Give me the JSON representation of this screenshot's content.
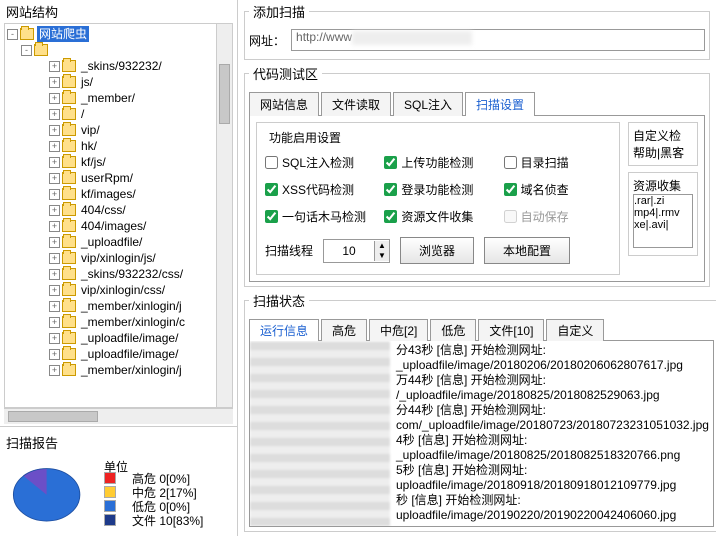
{
  "left": {
    "title": "网站结构",
    "root_label": "网站爬虫",
    "nodes": [
      "_skins/932232/",
      "js/",
      "_member/",
      "/",
      "vip/",
      "hk/",
      "kf/js/",
      "userRpm/",
      "kf/images/",
      "404/css/",
      "404/images/",
      "_uploadfile/",
      "vip/xinlogin/js/",
      "_skins/932232/css/",
      "vip/xinlogin/css/",
      "_member/xinlogin/j",
      "_member/xinlogin/c",
      "_uploadfile/image/",
      "_uploadfile/image/",
      "_member/xinlogin/j"
    ],
    "report_title": "扫描报告",
    "report_unit": "单位",
    "report_items": [
      {
        "label": "高危",
        "value": "0[0%]"
      },
      {
        "label": "中危",
        "value": "2[17%]"
      },
      {
        "label": "低危",
        "value": "0[0%]"
      },
      {
        "label": "文件",
        "value": "10[83%]"
      }
    ]
  },
  "chart_data": {
    "type": "pie",
    "title": "扫描报告",
    "categories": [
      "高危",
      "中危",
      "低危",
      "文件"
    ],
    "values": [
      0,
      17,
      0,
      83
    ],
    "colors": [
      "#e22222",
      "#ffcc33",
      "#2a6fd6",
      "#1e3a8a"
    ]
  },
  "add_scan": {
    "title": "添加扫描",
    "url_label": "网址：",
    "url_value": "http://www"
  },
  "code_test": {
    "title": "代码测试区",
    "tabs": [
      "网站信息",
      "文件读取",
      "SQL注入",
      "扫描设置"
    ],
    "active_tab": 3,
    "func_title": "功能启用设置",
    "checks": [
      {
        "label": "SQL注入检测",
        "checked": false
      },
      {
        "label": "上传功能检测",
        "checked": true
      },
      {
        "label": "目录扫描",
        "checked": false
      },
      {
        "label": "XSS代码检测",
        "checked": true
      },
      {
        "label": "登录功能检测",
        "checked": true
      },
      {
        "label": "域名侦查",
        "checked": true
      },
      {
        "label": "一句话木马检测",
        "checked": true
      },
      {
        "label": "资源文件收集",
        "checked": true
      },
      {
        "label": "自动保存",
        "checked": false,
        "disabled": true
      }
    ],
    "thread_label": "扫描线程",
    "thread_value": "10",
    "browser_btn": "浏览器",
    "local_btn": "本地配置",
    "custom_title": "自定义检",
    "custom_hint": "帮助|黑客",
    "resource_title": "资源收集",
    "resource_ext": ".rar|.zi\nmp4|.rmv\nxe|.avi|"
  },
  "scan_status": {
    "title": "扫描状态",
    "tabs": [
      "运行信息",
      "高危",
      "中危[2]",
      "低危",
      "文件[10]",
      "自定义"
    ],
    "active_tab": 0,
    "log_lines": [
      "分43秒      [信息]  开始检测网址:",
      "_uploadfile/image/20180206/20180206062807617.jpg",
      "万44秒      [信息]  开始检测网址:",
      "/_uploadfile/image/20180825/2018082529063.jpg",
      "分44秒      [信息]  开始检测网址:",
      "com/_uploadfile/image/20180723/20180723231051032.jpg",
      "4秒      [信息]  开始检测网址:",
      "_uploadfile/image/20180825/2018082518320766.png",
      "5秒      [信息]  开始检测网址:",
      "uploadfile/image/20180918/20180918012109779.jpg",
      "秒      [信息]  开始检测网址:",
      "uploadfile/image/20190220/20190220042406060.jpg"
    ]
  }
}
